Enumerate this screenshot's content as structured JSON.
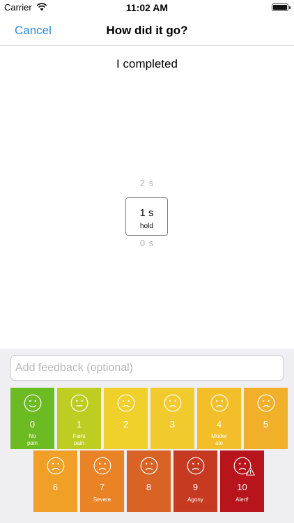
{
  "status": {
    "carrier": "Carrier",
    "time": "11:02 AM"
  },
  "nav": {
    "cancel": "Cancel",
    "title": "How did it go?"
  },
  "heading": "I completed",
  "picker": {
    "prev": "2 s",
    "value": "1 s",
    "unit": "hold",
    "next": "0 s"
  },
  "feedback": {
    "placeholder": "Add feedback (optional)",
    "value": ""
  },
  "pain_scale": [
    {
      "value": "0",
      "label": [
        "No",
        "pain"
      ],
      "color": "#6cbb22",
      "face": "smile"
    },
    {
      "value": "1",
      "label": [
        "Faint",
        "pain"
      ],
      "color": "#bdcd22",
      "face": "neutral"
    },
    {
      "value": "2",
      "label": [],
      "color": "#f0d02a",
      "face": "sad"
    },
    {
      "value": "3",
      "label": [],
      "color": "#f1cb2e",
      "face": "sad"
    },
    {
      "value": "4",
      "label": [
        "Moder",
        "ate"
      ],
      "color": "#f2bf2b",
      "face": "sad"
    },
    {
      "value": "5",
      "label": [],
      "color": "#f1b02a",
      "face": "sad"
    },
    {
      "value": "6",
      "label": [],
      "color": "#f0a026",
      "face": "sad"
    },
    {
      "value": "7",
      "label": [
        "Severe"
      ],
      "color": "#e98326",
      "face": "sad"
    },
    {
      "value": "8",
      "label": [],
      "color": "#d86325",
      "face": "sad"
    },
    {
      "value": "9",
      "label": [
        "Agony"
      ],
      "color": "#c73a22",
      "face": "sad"
    },
    {
      "value": "10",
      "label": [
        "Alert!"
      ],
      "color": "#b8141c",
      "face": "sad",
      "warning": true
    }
  ]
}
